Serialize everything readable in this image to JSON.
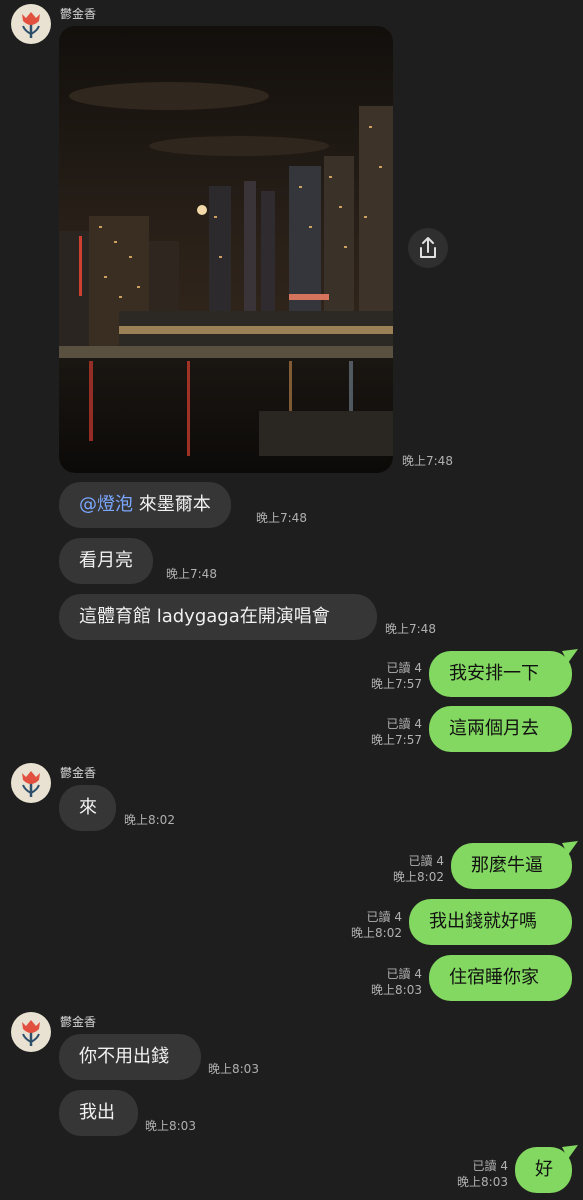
{
  "sender": {
    "name": "鬱金香"
  },
  "messages": {
    "m1_time": "晚上7:48",
    "m2_mention": "@燈泡",
    "m2_text": " 來墨爾本",
    "m2_time": "晚上7:48",
    "m3_text": "看月亮",
    "m3_time": "晚上7:48",
    "m4_text": "這體育館 ladygaga在開演唱會",
    "m4_time": "晚上7:48",
    "m5_text": "我安排一下",
    "m5_read": "已讀 4",
    "m5_time": "晚上7:57",
    "m6_text": "這兩個月去",
    "m6_read": "已讀 4",
    "m6_time": "晚上7:57",
    "m7_text": "來",
    "m7_time": "晚上8:02",
    "m8_text": "那麼牛逼",
    "m8_read": "已讀 4",
    "m8_time": "晚上8:02",
    "m9_text": "我出錢就好嗎",
    "m9_read": "已讀 4",
    "m9_time": "晚上8:02",
    "m10_text": "住宿睡你家",
    "m10_read": "已讀 4",
    "m10_time": "晚上8:03",
    "m11_text": "你不用出錢",
    "m11_time": "晚上8:03",
    "m12_text": "我出",
    "m12_time": "晚上8:03",
    "m13_text": "好",
    "m13_read": "已讀 4",
    "m13_time": "晚上8:03"
  },
  "icons": {
    "avatar": "tulip-icon",
    "share": "share-icon"
  },
  "colors": {
    "background": "#1e1e1e",
    "incoming_bubble": "#363636",
    "outgoing_bubble": "#82d860",
    "mention": "#7aa7ff"
  }
}
